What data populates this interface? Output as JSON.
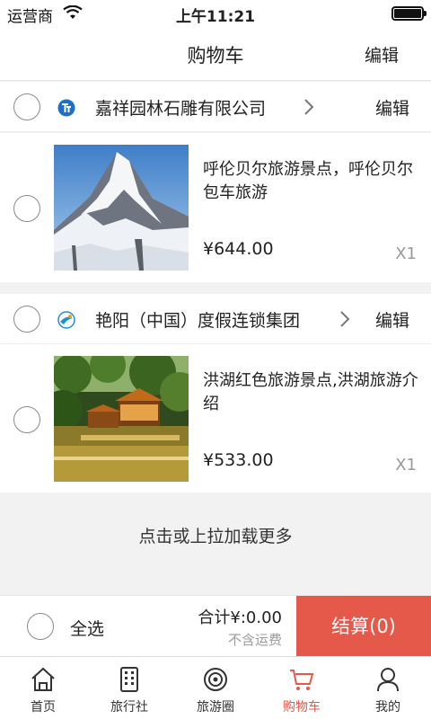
{
  "status_bar": {
    "carrier": "运营商",
    "time": "上午11:21"
  },
  "header": {
    "title": "购物车",
    "edit_label": "编辑"
  },
  "stores": [
    {
      "name": "嘉祥园林石雕有限公司",
      "edit_label": "编辑",
      "logo_icon": "company-logo-icon",
      "items": [
        {
          "name": "呼伦贝尔旅游景点，呼伦贝尔包车旅游",
          "price": "¥644.00",
          "qty": "X1",
          "image": "mountain-photo"
        }
      ]
    },
    {
      "name": "艳阳（中国）度假连锁集团",
      "edit_label": "编辑",
      "logo_icon": "company-logo-icon",
      "items": [
        {
          "name": "洪湖红色旅游景点,洪湖旅游介绍",
          "price": "¥533.00",
          "qty": "X1",
          "image": "pavilion-lake-photo"
        }
      ]
    }
  ],
  "load_more": "点击或上拉加载更多",
  "footer": {
    "select_all": "全选",
    "total": "合计¥:0.00",
    "shipping_note": "不含运费",
    "checkout": "结算(0)"
  },
  "tabs": [
    {
      "label": "首页",
      "icon": "home-icon"
    },
    {
      "label": "旅行社",
      "icon": "building-icon"
    },
    {
      "label": "旅游圈",
      "icon": "circle-target-icon"
    },
    {
      "label": "购物车",
      "icon": "cart-icon",
      "active": true
    },
    {
      "label": "我的",
      "icon": "person-icon"
    }
  ],
  "colors": {
    "accent": "#e5594b",
    "background": "#f2f2f2"
  }
}
